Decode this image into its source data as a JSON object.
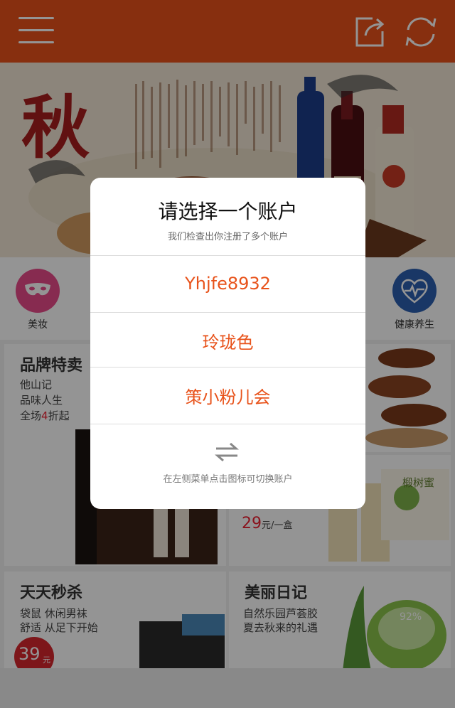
{
  "header": {
    "menu_icon": "menu-icon",
    "share_icon": "share-icon",
    "refresh_icon": "refresh-icon",
    "bg": "#e8521a"
  },
  "banner": {
    "calligraphy": "秋"
  },
  "categories": [
    {
      "label": "美妆",
      "icon": "mask-icon",
      "color": "#e84a8a"
    },
    {
      "label": "健康养生",
      "icon": "heart-pulse-icon",
      "color": "#2b5fb0"
    }
  ],
  "cards": {
    "brand_sale": {
      "title": "品牌特卖",
      "line1": "他山记",
      "line2": "品味人生",
      "line3_prefix": "全场",
      "line3_num": "4",
      "line3_suffix": "折起"
    },
    "honey": {
      "price": "29",
      "unit": "元/一盒",
      "badge": "椴树蜜"
    },
    "flash_sale": {
      "title": "天天秒杀",
      "line1": "袋鼠 休闲男袜",
      "line2": "舒适 从足下开始",
      "price": "39",
      "unit": "元"
    },
    "beauty_diary": {
      "title": "美丽日记",
      "line1": "自然乐园芦荟胶",
      "line2": "夏去秋来的礼遇",
      "badge": "92%"
    }
  },
  "dialog": {
    "title": "请选择一个账户",
    "subtitle": "我们检查出你注册了多个账户",
    "accounts": [
      "Yhjfe8932",
      "玲珑色",
      "策小粉儿会"
    ],
    "switch_icon": "switch-arrows-icon",
    "hint": "在左侧菜单点击图标可切换账户",
    "accent": "#e8521a"
  }
}
